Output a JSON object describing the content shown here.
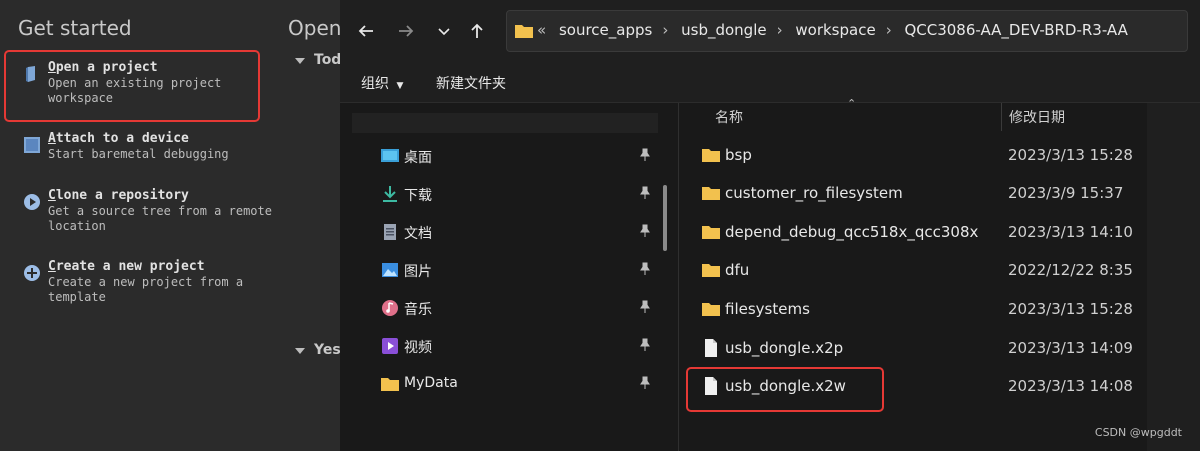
{
  "ide": {
    "get_started_title": "Get started",
    "open_title": "Open",
    "items": [
      {
        "title": "Open a project",
        "desc": "Open an existing project workspace"
      },
      {
        "title": "Attach to a device",
        "desc": "Start baremetal debugging"
      },
      {
        "title": "Clone a repository",
        "desc": "Get a source tree from a remote location"
      },
      {
        "title": "Create a new project",
        "desc": "Create a new project from a template"
      }
    ],
    "sections": {
      "today": "Tod",
      "yesterday": "Yes"
    }
  },
  "explorer": {
    "address": {
      "overflow": "«",
      "crumbs": [
        "source_apps",
        "usb_dongle",
        "workspace",
        "QCC3086-AA_DEV-BRD-R3-AA"
      ]
    },
    "commands": {
      "organize": "组织",
      "new_folder": "新建文件夹"
    },
    "quick_access": [
      {
        "label": "桌面",
        "icon": "desktop-icon"
      },
      {
        "label": "下载",
        "icon": "download-icon"
      },
      {
        "label": "文档",
        "icon": "document-icon"
      },
      {
        "label": "图片",
        "icon": "pictures-icon"
      },
      {
        "label": "音乐",
        "icon": "music-icon"
      },
      {
        "label": "视频",
        "icon": "video-icon"
      },
      {
        "label": "MyData",
        "icon": "folder-icon"
      }
    ],
    "columns": {
      "name": "名称",
      "date": "修改日期"
    },
    "files": [
      {
        "name": "bsp",
        "date": "2023/3/13 15:28",
        "type": "folder"
      },
      {
        "name": "customer_ro_filesystem",
        "date": "2023/3/9 15:37",
        "type": "folder"
      },
      {
        "name": "depend_debug_qcc518x_qcc308x",
        "date": "2023/3/13 14:10",
        "type": "folder"
      },
      {
        "name": "dfu",
        "date": "2022/12/22 8:35",
        "type": "folder"
      },
      {
        "name": "filesystems",
        "date": "2023/3/13 15:28",
        "type": "folder"
      },
      {
        "name": "usb_dongle.x2p",
        "date": "2023/3/13 14:09",
        "type": "file"
      },
      {
        "name": "usb_dongle.x2w",
        "date": "2023/3/13 14:08",
        "type": "file"
      }
    ]
  },
  "watermark": "CSDN @wpgddt",
  "colors": {
    "highlight": "#e53935",
    "folder": "#f2c14e"
  }
}
